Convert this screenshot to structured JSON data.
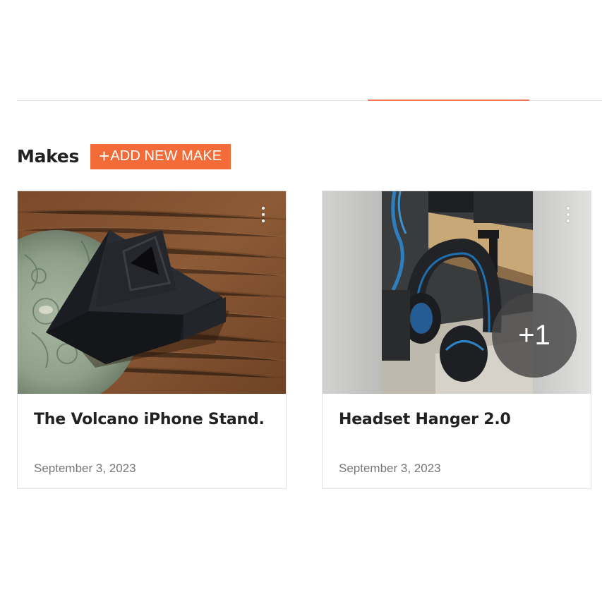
{
  "section": {
    "title": "Makes",
    "add_button_label": "ADD NEW MAKE"
  },
  "makes": [
    {
      "title": "The Volcano iPhone Stand.",
      "date": "September 3, 2023"
    },
    {
      "title": "Headset Hanger 2.0",
      "date": "September 3, 2023",
      "more_photos": "+1"
    }
  ],
  "colors": {
    "accent": "#f26b38",
    "tab_indicator": "#f07556"
  }
}
